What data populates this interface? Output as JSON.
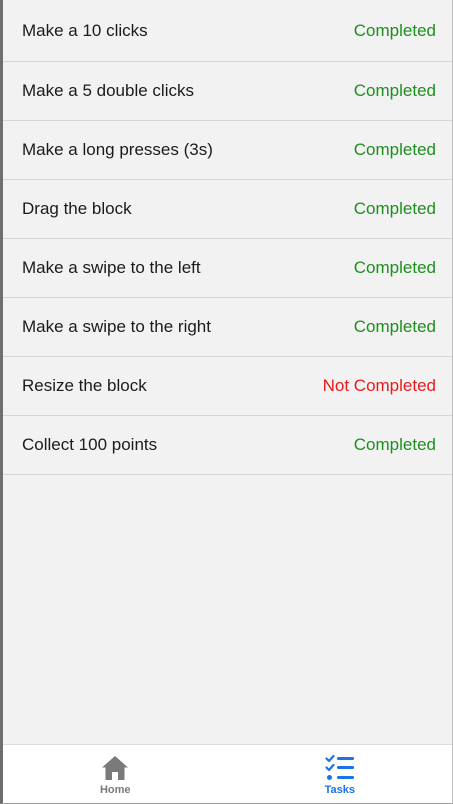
{
  "tasks": [
    {
      "label": "Make a 10 clicks",
      "status": "Completed",
      "done": true
    },
    {
      "label": "Make a 5 double clicks",
      "status": "Completed",
      "done": true
    },
    {
      "label": "Make a long presses (3s)",
      "status": "Completed",
      "done": true
    },
    {
      "label": "Drag the block",
      "status": "Completed",
      "done": true
    },
    {
      "label": "Make a swipe to the left",
      "status": "Completed",
      "done": true
    },
    {
      "label": "Make a swipe to the right",
      "status": "Completed",
      "done": true
    },
    {
      "label": "Resize the block",
      "status": "Not Completed",
      "done": false
    },
    {
      "label": "Collect 100 points",
      "status": "Completed",
      "done": true
    }
  ],
  "tabbar": {
    "home": {
      "label": "Home",
      "icon": "home-icon",
      "active": false
    },
    "tasks": {
      "label": "Tasks",
      "icon": "checklist-icon",
      "active": true
    }
  },
  "colors": {
    "completed": "#1e8f1e",
    "not_completed": "#e81c1c",
    "active_tab": "#1a73e8",
    "inactive_tab": "#7a7a7a",
    "list_background": "#f2f2f2"
  }
}
